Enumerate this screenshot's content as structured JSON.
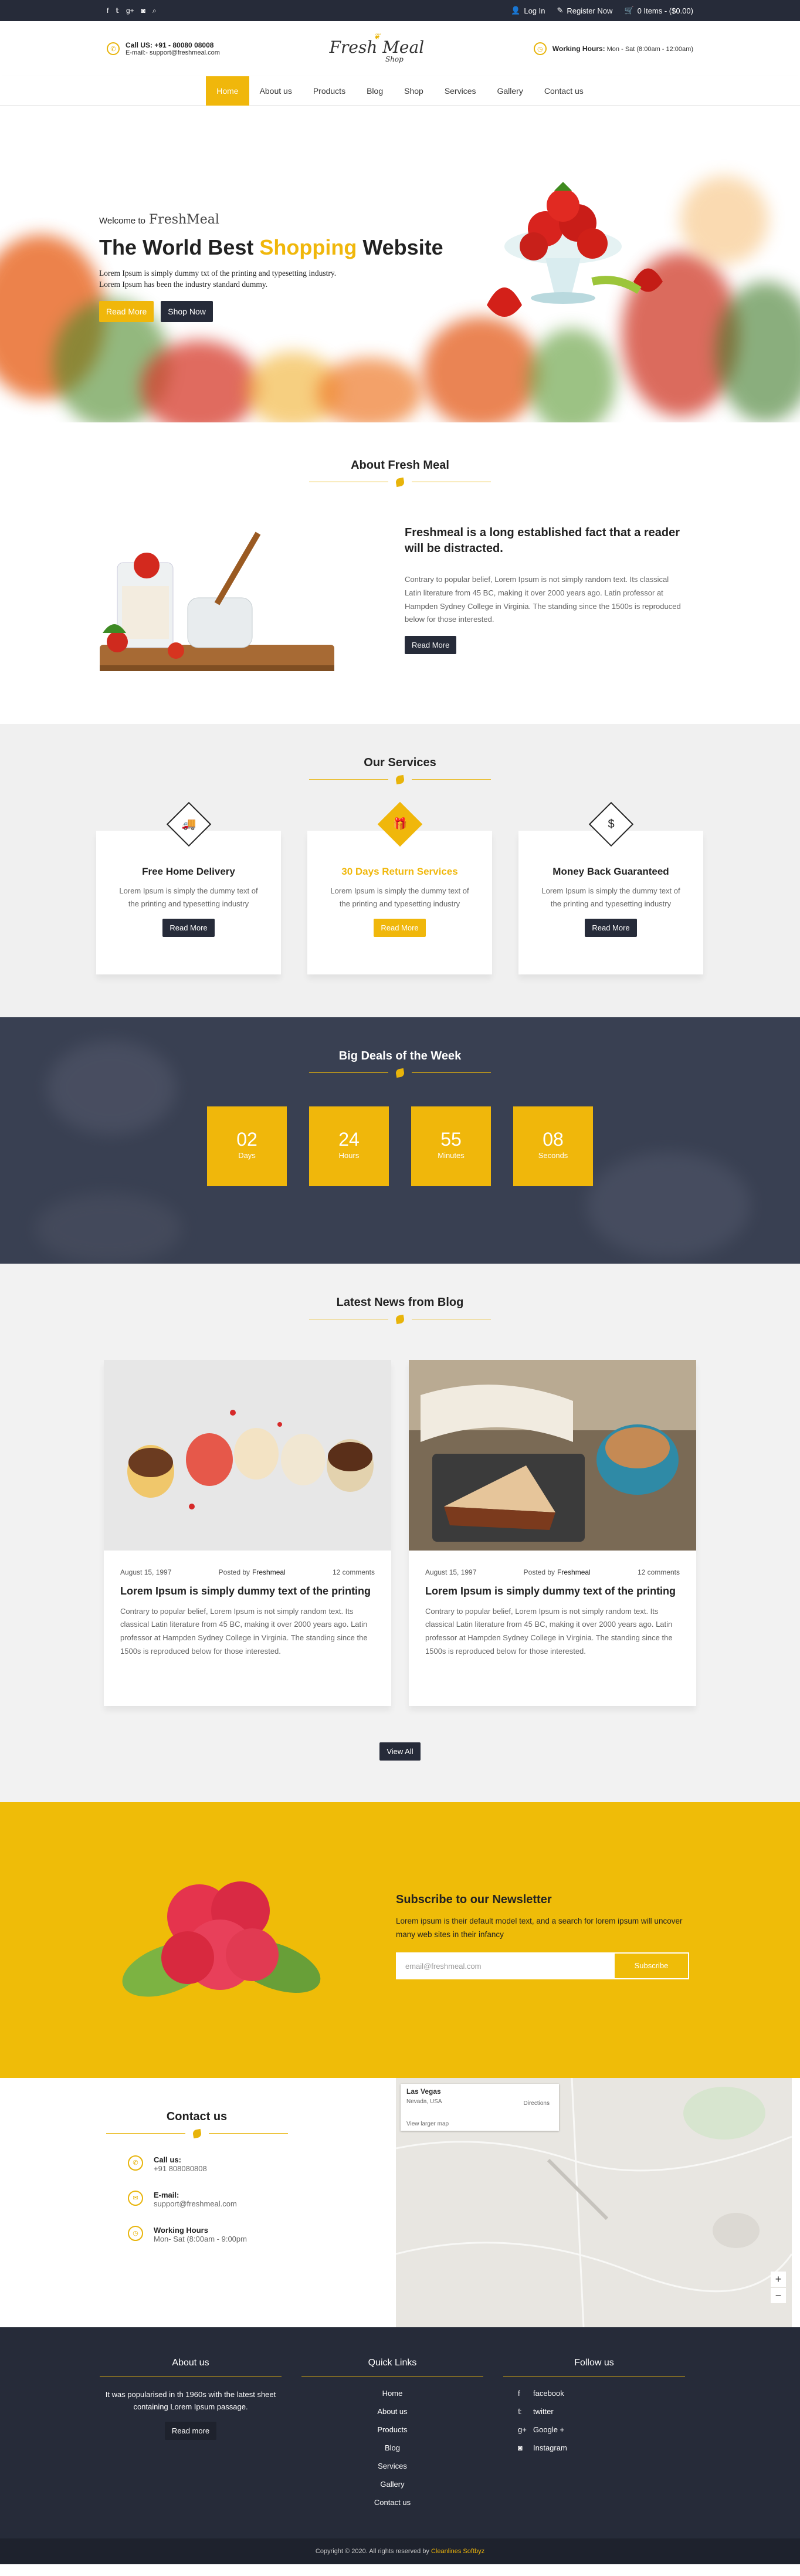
{
  "topbar": {
    "social": [
      "f",
      "t",
      "g+",
      "ig",
      "search"
    ],
    "login": "Log In",
    "register": "Register Now",
    "cart": "0 Items - ($0.00)"
  },
  "header": {
    "call_label": "Call US: +91 - 80080 08008",
    "email": "E-mail:- support@freshmeal.com",
    "logo": "Fresh Meal",
    "logo_sub": "Shop",
    "hours_label": "Working Hours:",
    "hours": "Mon - Sat (8:00am - 12:00am)"
  },
  "nav": [
    "Home",
    "About us",
    "Products",
    "Blog",
    "Shop",
    "Services",
    "Gallery",
    "Contact us"
  ],
  "hero": {
    "welcome": "Welcome to",
    "brand": "FreshMeal",
    "title_a": "The World Best ",
    "title_hl": "Shopping",
    "title_b": " Website",
    "line1": "Lorem Ipsum is simply dummy txt of the printing and typesetting industry.",
    "line2": "Lorem Ipsum has been the industry standard dummy.",
    "btn1": "Read More",
    "btn2": "Shop Now"
  },
  "about": {
    "title": "About Fresh Meal",
    "heading": "Freshmeal is a long established fact that a reader will be distracted.",
    "text": "Contrary to popular belief, Lorem Ipsum is not simply random text. Its classical Latin literature from 45 BC, making it over 2000 years ago. Latin professor at Hampden Sydney College in Virginia. The standing since the 1500s is reproduced below for those interested.",
    "btn": "Read More"
  },
  "services": {
    "title": "Our Services",
    "items": [
      {
        "icon": "truck-icon",
        "glyph": "🚚",
        "title": "Free Home Delivery",
        "text": "Lorem Ipsum is simply the dummy text of the printing and typesetting industry",
        "btn": "Read More"
      },
      {
        "icon": "gift-icon",
        "glyph": "🎁",
        "title": "30 Days Return Services",
        "text": "Lorem Ipsum is simply the dummy text of the printing and typesetting industry",
        "btn": "Read More"
      },
      {
        "icon": "dollar-icon",
        "glyph": "$",
        "title": "Money Back Guaranteed",
        "text": "Lorem Ipsum is simply the dummy text of the printing and typesetting industry",
        "btn": "Read More"
      }
    ]
  },
  "deals": {
    "title": "Big Deals of the Week",
    "timer": [
      {
        "v": "02",
        "l": "Days"
      },
      {
        "v": "24",
        "l": "Hours"
      },
      {
        "v": "55",
        "l": "Minutes"
      },
      {
        "v": "08",
        "l": "Seconds"
      }
    ]
  },
  "news": {
    "title": "Latest News from Blog",
    "posts": [
      {
        "date": "August 15, 1997",
        "by": "Posted by",
        "author": "Freshmeal",
        "comments": "12 comments",
        "title": "Lorem Ipsum is simply dummy text of the printing",
        "text": "Contrary to popular belief, Lorem Ipsum is not simply random text. Its classical Latin literature from 45 BC, making it over 2000 years ago. Latin professor at Hampden Sydney College in Virginia. The standing since the 1500s is reproduced below for those interested."
      },
      {
        "date": "August 15, 1997",
        "by": "Posted by",
        "author": "Freshmeal",
        "comments": "12 comments",
        "title": "Lorem Ipsum is simply dummy text of the printing",
        "text": "Contrary to popular belief, Lorem Ipsum is not simply random text. Its classical Latin literature from 45 BC, making it over 2000 years ago. Latin professor at Hampden Sydney College in Virginia. The standing since the 1500s is reproduced below for those interested."
      }
    ],
    "viewall": "View All"
  },
  "newsletter": {
    "title": "Subscribe to our Newsletter",
    "text": "Lorem ipsum is their default model text, and a search for lorem ipsum will uncover many web sites in their infancy",
    "placeholder": "email@freshmeal.com",
    "btn": "Subscribe"
  },
  "contact": {
    "title": "Contact us",
    "items": [
      {
        "label": "Call us:",
        "value": "+91 808080808"
      },
      {
        "label": "E-mail:",
        "value": "support@freshmeal.com"
      },
      {
        "label": "Working Hours",
        "value": "Mon- Sat (8:00am - 9:00pm"
      }
    ]
  },
  "map": {
    "place": "Las Vegas",
    "region": "Nevada, USA",
    "directions": "Directions",
    "larger": "View larger map"
  },
  "footer": {
    "about_title": "About us",
    "about_text": "It was popularised in th 1960s with the latest sheet containing Lorem Ipsum passage.",
    "about_btn": "Read more",
    "links_title": "Quick Links",
    "links": [
      "Home",
      "About us",
      "Products",
      "Blog",
      "Services",
      "Gallery",
      "Contact us"
    ],
    "follow_title": "Follow us",
    "follow": [
      "facebook",
      "twitter",
      "Google +",
      "Instagram"
    ],
    "copy": "Copyright © 2020. All rights reserved by ",
    "copy_brand": "Cleanlines Softbyz"
  }
}
